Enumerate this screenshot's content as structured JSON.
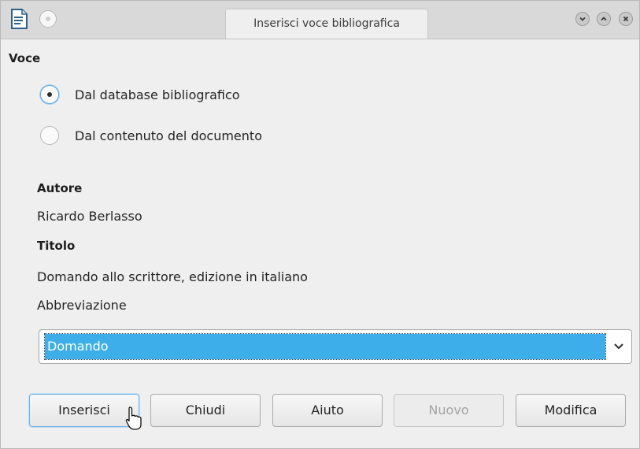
{
  "window": {
    "title": "Inserisci voce bibliografica"
  },
  "entry": {
    "section_label": "Voce",
    "options": [
      {
        "label": "Dal database bibliografico",
        "checked": true
      },
      {
        "label": "Dal contenuto del documento",
        "checked": false
      }
    ]
  },
  "details": {
    "author_label": "Autore",
    "author_value": "Ricardo Berlasso",
    "title_label": "Titolo",
    "title_value": "Domando allo scrittore, edizione in italiano",
    "short_name_label": "Abbreviazione",
    "short_name_value": "Domando"
  },
  "buttons": {
    "insert": "Inserisci",
    "close": "Chiudi",
    "help": "Aiuto",
    "new": "Nuovo",
    "edit": "Modifica"
  },
  "icons": [
    "document-icon",
    "window-menu-icon",
    "minimize-icon",
    "maximize-icon",
    "close-icon",
    "chevron-down-icon",
    "mouse-pointer-icon"
  ],
  "colors": {
    "selection": "#3daee9",
    "window_bg": "#efefef",
    "titlebar_bg": "#d9d9d9"
  }
}
